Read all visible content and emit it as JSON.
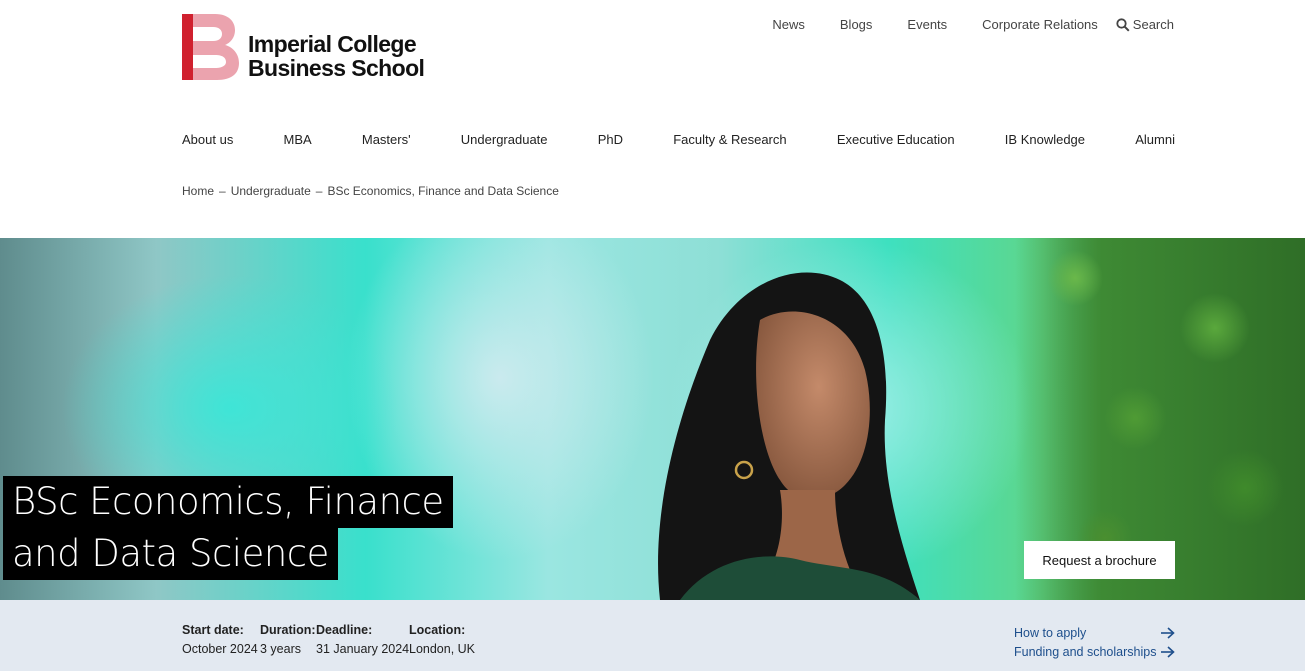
{
  "header": {
    "logo_alt": "Imperial College Business School",
    "logo_line1": "Imperial College",
    "logo_line2": "Business School",
    "utility_nav": [
      "News",
      "Blogs",
      "Events",
      "Corporate Relations"
    ],
    "search_label": "Search"
  },
  "main_nav": [
    "About us",
    "MBA",
    "Masters'",
    "Undergraduate",
    "PhD",
    "Faculty & Research",
    "Executive Education",
    "IB Knowledge",
    "Alumni"
  ],
  "breadcrumb": {
    "items": [
      "Home",
      "Undergraduate",
      "BSc Economics, Finance and Data Science"
    ],
    "separator": "–"
  },
  "hero": {
    "title_line1": "BSc Economics, Finance",
    "title_line2": "and Data Science",
    "brochure_button": "Request a brochure"
  },
  "facts": {
    "start_label": "Start date:",
    "start_value": "October 2024",
    "duration_label": "Duration:",
    "duration_value": "3 years",
    "deadline_label": "Deadline:",
    "deadline_value": "31 January 2024",
    "location_label": "Location:",
    "location_value": "London, UK"
  },
  "links": {
    "how_to_apply": "How to apply",
    "funding": "Funding and scholarships"
  },
  "colors": {
    "brand_red": "#d0202e",
    "brand_pink": "#eba3ae",
    "info_bar_bg": "#e3e9f1",
    "link_blue": "#1e4f8c"
  }
}
